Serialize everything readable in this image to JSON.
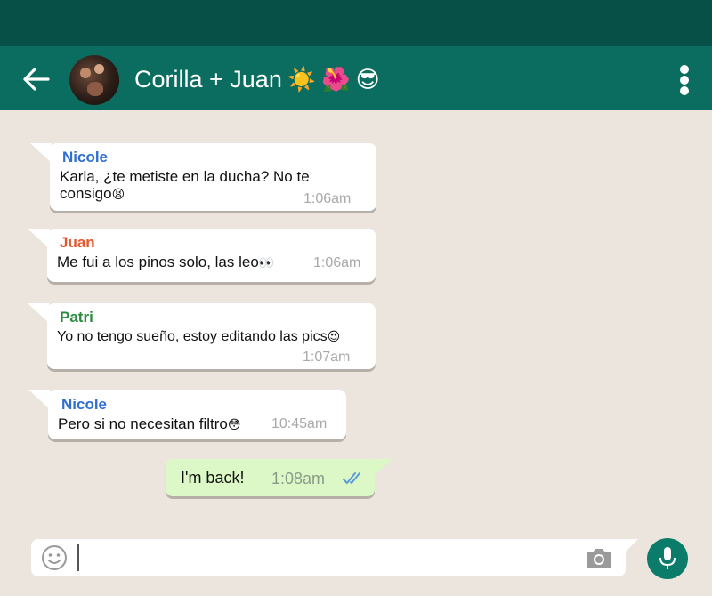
{
  "header": {
    "title": "Corilla + Juan",
    "title_emojis": [
      "☀️",
      "🌺",
      "😎"
    ],
    "back_icon": "arrow-left-icon",
    "menu_icon": "more-vertical-icon",
    "avatar": "group-avatar"
  },
  "messages": [
    {
      "sender": "Nicole",
      "sender_color": "#2f6fcf",
      "text_line1": "Karla, ¿te metiste en la ducha? No te",
      "text_line2": "consigo",
      "emoji": "😫",
      "time": "1:06am"
    },
    {
      "sender": "Juan",
      "sender_color": "#e4572e",
      "text": "Me fui a los pinos solo, las leo",
      "emoji": "👀",
      "time": "1:06am"
    },
    {
      "sender": "Patri",
      "sender_color": "#2b8a3e",
      "text": "Yo no tengo sueño, estoy editando las pics",
      "emoji": "😍",
      "time": "1:07am"
    },
    {
      "sender": "Nicole",
      "sender_color": "#2f6fcf",
      "text": "Pero si no necesitan filtro",
      "emoji": "😳",
      "time": "10:45am"
    }
  ],
  "outgoing": {
    "text": "I'm back!",
    "time": "1:08am",
    "status_icon": "double-check-icon",
    "status_color": "#5b9bd5"
  },
  "input": {
    "placeholder": "",
    "emoji_icon": "smiley-icon",
    "camera_icon": "camera-icon",
    "mic_icon": "microphone-icon"
  },
  "colors": {
    "statusbar": "#075048",
    "header": "#0b6d5f",
    "background": "#ece5dd",
    "outgoing_bubble": "#dcf8c6",
    "mic_button": "#0b7b6a"
  }
}
